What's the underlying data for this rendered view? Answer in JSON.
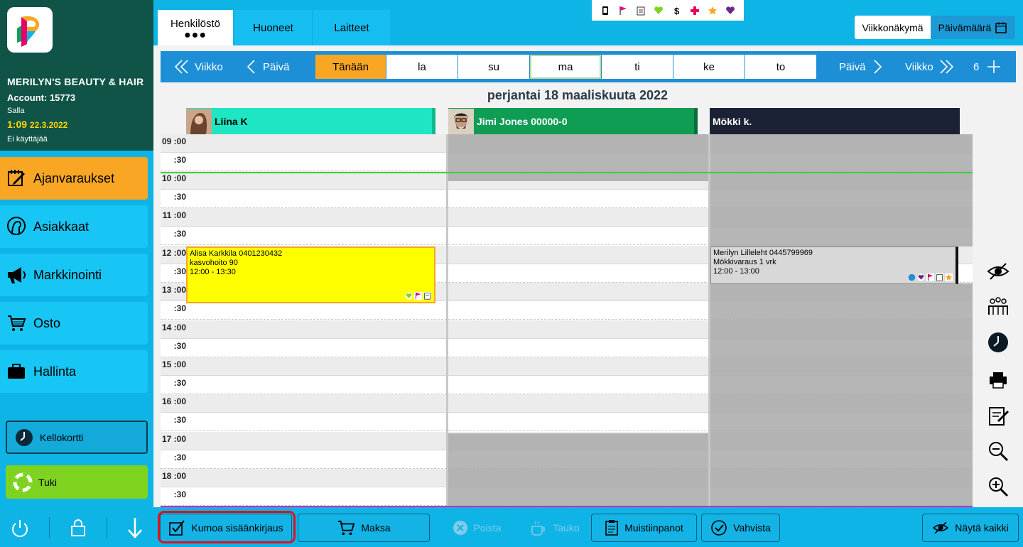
{
  "sidebar": {
    "business_name": "MERILYN'S BEAUTY & HAIR",
    "account": "Account: 15773",
    "user": "Salla",
    "time": "1:09",
    "date": "22.3.2022",
    "no_user": "Ei käyttäjää",
    "nav": [
      {
        "label": "Ajanvaraukset",
        "icon": "calendar-edit-icon",
        "active": true
      },
      {
        "label": "Asiakkaat",
        "icon": "customer-head-icon"
      },
      {
        "label": "Markkinointi",
        "icon": "megaphone-icon"
      },
      {
        "label": "Osto",
        "icon": "cart-icon"
      },
      {
        "label": "Hallinta",
        "icon": "briefcase-icon"
      }
    ],
    "kellokortti": "Kellokortti",
    "tuki": "Tuki"
  },
  "tabs": [
    {
      "label": "Henkilöstö",
      "active": true
    },
    {
      "label": "Huoneet"
    },
    {
      "label": "Laitteet"
    }
  ],
  "legend_icons": [
    "phone-icon",
    "flag-icon",
    "clipboard-icon",
    "heart-green-icon",
    "dollar-icon",
    "cross-icon",
    "star-icon",
    "heart-purple-icon"
  ],
  "view_buttons": {
    "week": "Viikkonäkymä",
    "date": "Päivämäärä"
  },
  "navbar": {
    "prev_week": "Viikko",
    "prev_day": "Päivä",
    "today": "Tänään",
    "days": [
      "la",
      "su",
      "ma",
      "ti",
      "ke",
      "to"
    ],
    "next_day": "Päivä",
    "next_week": "Viikko",
    "count": "6"
  },
  "date_title": "perjantai 18 maaliskuuta 2022",
  "staff": [
    {
      "name": "Liina K",
      "color": "#1ee6c2",
      "accent": "#0fb98f"
    },
    {
      "name": "Jimi Jones 00000-0",
      "color": "#0f9d54",
      "accent": "#0b6e3a"
    },
    {
      "name": "Mökki k.",
      "color": "#1b2235",
      "accent": "#1b2235"
    }
  ],
  "time_slots": [
    "09 :00",
    ":30",
    "10 :00",
    ":30",
    "11 :00",
    ":30",
    "12 :00",
    ":30",
    "13 :00",
    ":30",
    "14 :00",
    ":30",
    "15 :00",
    ":30",
    "16 :00",
    ":30",
    "17 :00",
    ":30",
    "18 :00",
    ":30"
  ],
  "appointments": [
    {
      "line1": "Alisa Karkkila 0401230432",
      "line2": "kasvohoito 90",
      "line3": "12:00 - 13:30",
      "color": "#ffff00"
    },
    {
      "line1": "Merilyn Lilleleht 0445799969",
      "line2": "Mökkivaraus 1 vrk",
      "line3": "12:00 - 13:00",
      "color": "#d8d8d8"
    }
  ],
  "side_tools": [
    "eye-icon",
    "group-icon",
    "clock-icon",
    "printer-icon",
    "notes-icon",
    "zoom-out-icon",
    "zoom-in-icon"
  ],
  "bottom": {
    "undo": "Kumoa sisäänkirjaus",
    "pay": "Maksa",
    "delete": "Poista",
    "break": "Tauko",
    "notes": "Muistiinpanot",
    "confirm": "Vahvista",
    "show_all": "Näytä kaikki"
  }
}
